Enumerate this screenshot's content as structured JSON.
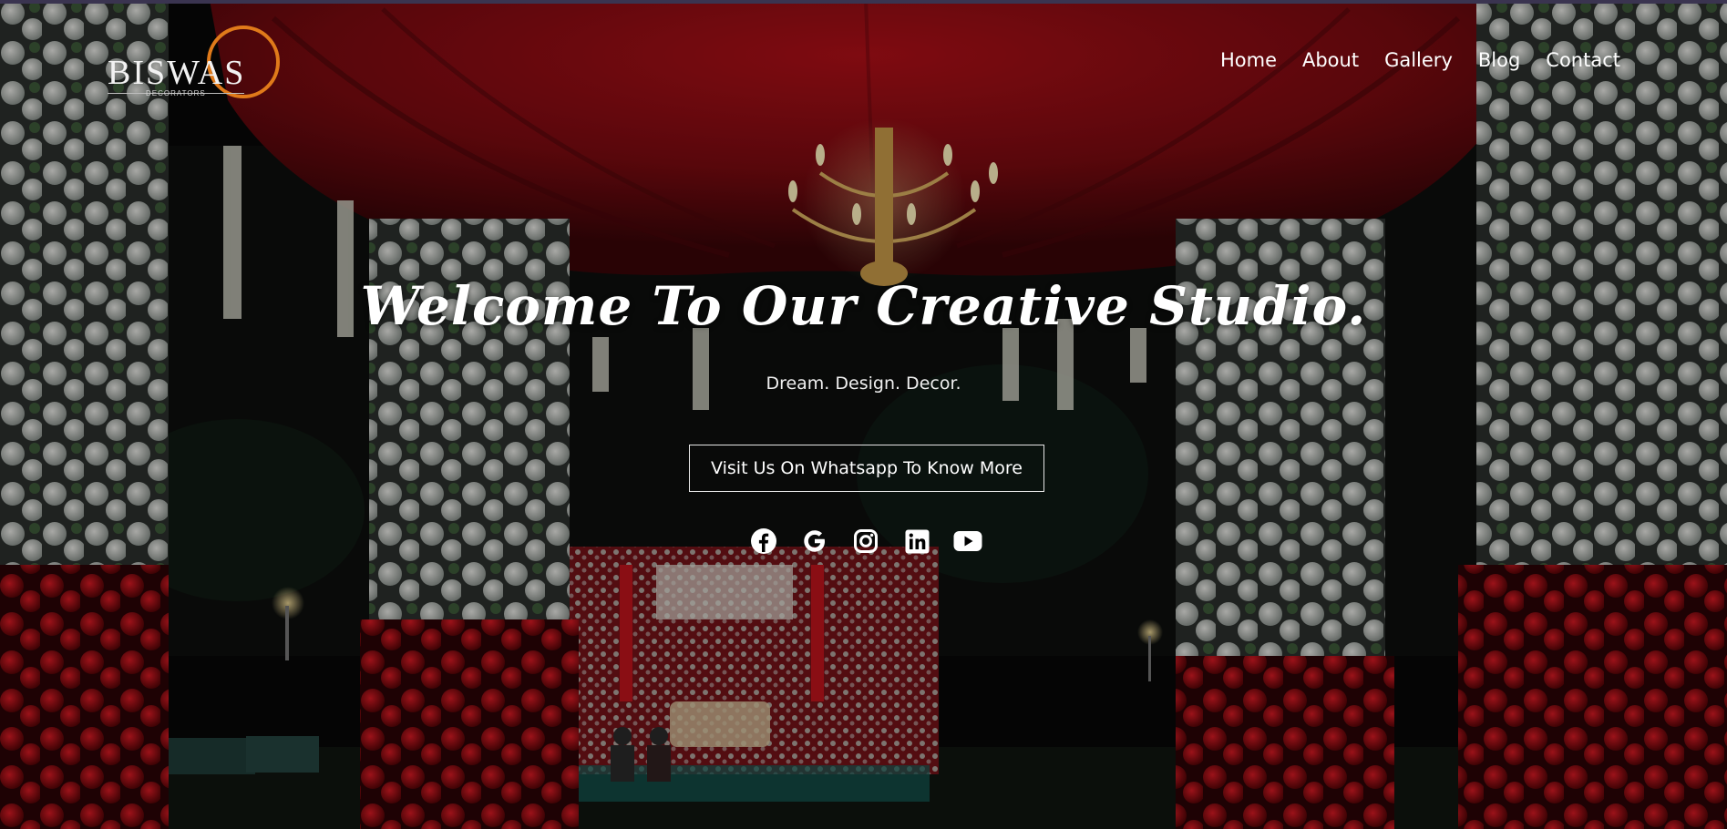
{
  "brand": {
    "name": "BISWAS",
    "sub": "DECORATORS",
    "accent": "#e07a1a"
  },
  "nav": {
    "items": [
      {
        "label": "Home"
      },
      {
        "label": "About"
      },
      {
        "label": "Gallery"
      },
      {
        "label": "Blog"
      },
      {
        "label": "Contact"
      }
    ]
  },
  "hero": {
    "headline": "Welcome To Our Creative Studio.",
    "tagline": "Dream. Design. Decor.",
    "cta_label": "Visit Us On Whatsapp To Know More"
  },
  "socials": [
    {
      "icon": "facebook-icon"
    },
    {
      "icon": "google-icon"
    },
    {
      "icon": "instagram-icon"
    },
    {
      "icon": "linkedin-icon"
    },
    {
      "icon": "youtube-icon"
    }
  ],
  "colors": {
    "curtain": "#8a0c14",
    "rose": "#b3101c",
    "flower_white": "#d9d9d4",
    "text": "#ffffff"
  }
}
